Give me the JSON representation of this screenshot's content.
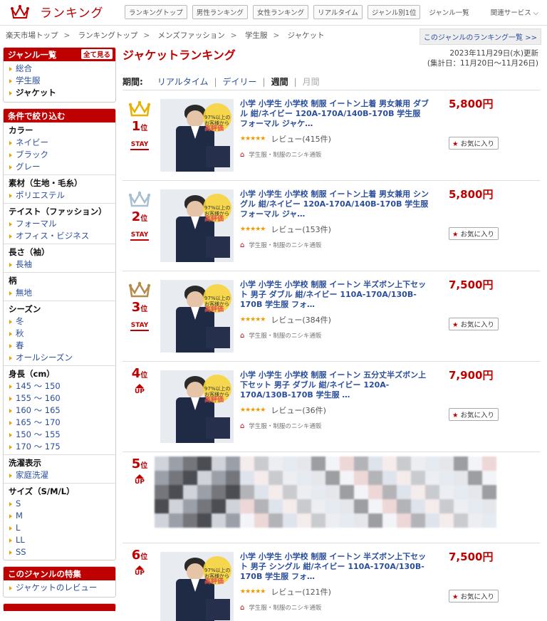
{
  "header": {
    "title": "ランキング",
    "nav": [
      "ランキングトップ",
      "男性ランキング",
      "女性ランキング",
      "リアルタイム",
      "ジャンル別1位"
    ],
    "right": [
      "ジャンル一覧",
      "関連サービス"
    ]
  },
  "breadcrumb": [
    "楽天市場トップ",
    "ランキングトップ",
    "メンズファッション",
    "学生服",
    "ジャケット"
  ],
  "genre_link": "このジャンルのランキング一覧 >>",
  "sidebar": {
    "genre": {
      "title": "ジャンル一覧",
      "see_all": "全て見る",
      "items": [
        "総合",
        "学生服",
        "ジャケット"
      ]
    },
    "filter": {
      "title": "条件で絞り込む",
      "groups": [
        {
          "title": "カラー",
          "items": [
            "ネイビー",
            "ブラック",
            "グレー"
          ]
        },
        {
          "title": "素材（生地・毛糸）",
          "items": [
            "ポリエステル"
          ]
        },
        {
          "title": "テイスト（ファッション）",
          "items": [
            "フォーマル",
            "オフィス・ビジネス"
          ]
        },
        {
          "title": "長さ（袖）",
          "items": [
            "長袖"
          ]
        },
        {
          "title": "柄",
          "items": [
            "無地"
          ]
        },
        {
          "title": "シーズン",
          "items": [
            "冬",
            "秋",
            "春",
            "オールシーズン"
          ]
        },
        {
          "title": "身長（cm）",
          "items": [
            "145 ～ 150",
            "155 ～ 160",
            "160 ～ 165",
            "165 ～ 170",
            "150 ～ 155",
            "170 ～ 175"
          ]
        },
        {
          "title": "洗濯表示",
          "items": [
            "家庭洗濯"
          ]
        },
        {
          "title": "サイズ（S/M/L）",
          "items": [
            "S",
            "M",
            "L",
            "LL",
            "SS"
          ]
        }
      ]
    },
    "feature": {
      "title": "このジャンルの特集",
      "items": [
        "ジャケットのレビュー"
      ]
    }
  },
  "main": {
    "title": "ジャケットランキング",
    "updated": "2023年11月29日(水)更新",
    "period_range": "(集計日：11月20日～11月26日)",
    "period_label": "期間:",
    "periods": [
      "リアルタイム",
      "デイリー",
      "週間",
      "月間"
    ]
  },
  "fav_label": "お気に入り",
  "items": [
    {
      "rank": "1",
      "rank_suffix": "位",
      "status": "STAY",
      "title": "小学 小学生 小学校 制服 イートン上着 男女兼用 ダブル 紺/ネイビー 120A-170A/140B-170B 学生服 フォーマル ジャケ…",
      "reviews": "レビュー(415件)",
      "shop": "学生服・制服のニシキ通販",
      "price": "5,800円",
      "crown": "#e8b000"
    },
    {
      "rank": "2",
      "rank_suffix": "位",
      "status": "STAY",
      "title": "小学 小学生 小学校 制服 イートン上着 男女兼用 シングル 紺/ネイビー 120A-170A/140B-170B 学生服 フォーマル ジャ…",
      "reviews": "レビュー(153件)",
      "shop": "学生服・制服のニシキ通販",
      "price": "5,800円",
      "crown": "#a9bfd0"
    },
    {
      "rank": "3",
      "rank_suffix": "位",
      "status": "STAY",
      "title": "小学 小学生 小学校 制服 イートン 半ズボン上下セット 男子 ダブル 紺/ネイビー 110A-170A/130B-170B 学生服 フォ…",
      "reviews": "レビュー(384件)",
      "shop": "学生服・制服のニシキ通販",
      "price": "7,500円",
      "crown": "#b58b4a"
    },
    {
      "rank": "4",
      "rank_suffix": "位",
      "status": "UP",
      "title": "小学 小学生 小学校 制服 イートン 五分丈半ズボン上下セット 男子 ダブル 紺/ネイビー 120A-170A/130B-170B 学生服 …",
      "reviews": "レビュー(36件)",
      "shop": "学生服・制服のニシキ通販",
      "price": "7,900円",
      "crown": ""
    },
    {
      "rank": "5",
      "rank_suffix": "位",
      "status": "UP",
      "title": "",
      "reviews": "",
      "shop": "",
      "price": "",
      "crown": ""
    },
    {
      "rank": "6",
      "rank_suffix": "位",
      "status": "UP",
      "title": "小学 小学生 小学校 制服 イートン 半ズボン上下セット 男子 シングル 紺/ネイビー 110A-170A/130B-170B 学生服 フォ…",
      "reviews": "レビュー(121件)",
      "shop": "学生服・制服のニシキ通販",
      "price": "7,500円",
      "crown": ""
    }
  ],
  "thumb_badge": {
    "a": "97%以上の",
    "b": "お客様から",
    "c": "高評価"
  }
}
